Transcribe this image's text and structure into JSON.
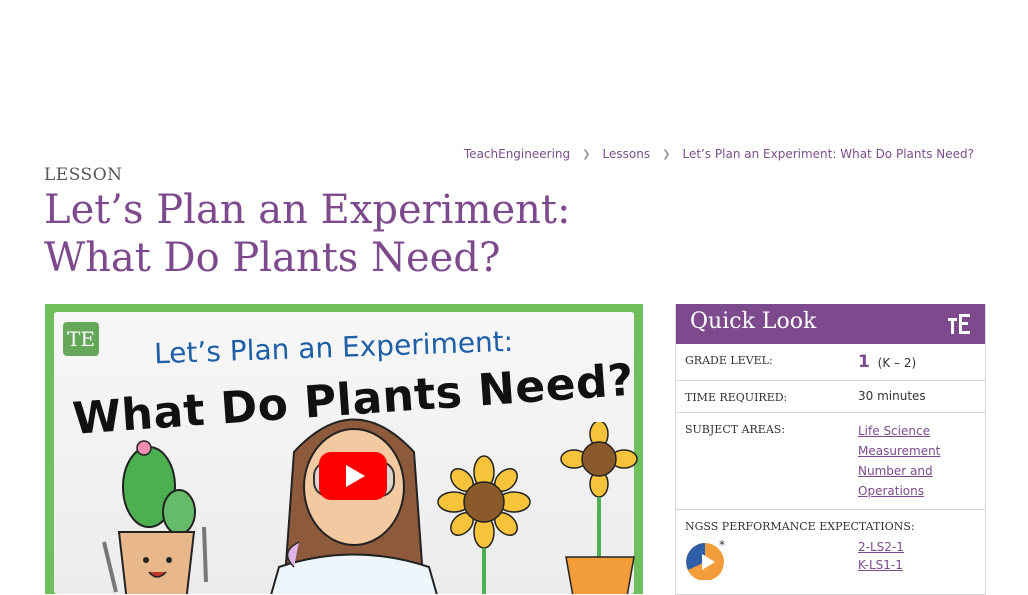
{
  "breadcrumb": {
    "items": [
      "TeachEngineering",
      "Lessons",
      "Let’s Plan an Experiment: What Do Plants Need?"
    ]
  },
  "page": {
    "type_label": "LESSON",
    "title_line1": "Let’s Plan an Experiment:",
    "title_line2": "What Do Plants Need?"
  },
  "video": {
    "badge": "TE",
    "line1": "Let’s Plan an Experiment:",
    "line2": "What Do Plants Need?"
  },
  "quick_look": {
    "title": "Quick Look",
    "grade_label": "GRADE LEVEL:",
    "grade_value": "1",
    "grade_range": "(K – 2)",
    "time_label": "TIME REQUIRED:",
    "time_value": "30 minutes",
    "subjects_label": "SUBJECT AREAS:",
    "subjects": [
      "Life Science",
      "Measurement",
      "Number and",
      "Operations"
    ],
    "ngss_label": "NGSS PERFORMANCE EXPECTATIONS:",
    "ngss_mark": "*",
    "ngss_codes": [
      "2-LS2-1",
      "K-LS1-1"
    ]
  },
  "colors": {
    "brand_purple": "#7d4a8d",
    "youtube_red": "#ff0000",
    "video_border_green": "#6fbf5c"
  }
}
